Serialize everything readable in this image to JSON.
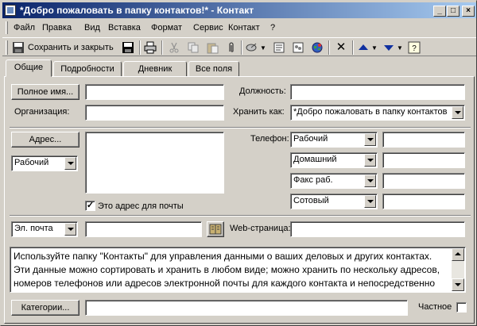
{
  "window": {
    "title": "*Добро пожаловать в папку контактов!* - Контакт",
    "buttons": [
      "_",
      "□",
      "×"
    ]
  },
  "menubar": {
    "items": [
      "Файл",
      "Правка",
      "Вид",
      "Вставка",
      "Формат",
      "Сервис",
      "Контакт",
      "?"
    ]
  },
  "toolbar": {
    "save_close_label": "Сохранить и закрыть"
  },
  "tabs": [
    "Общие",
    "Подробности",
    "Дневник",
    "Все поля"
  ],
  "general": {
    "full_name_button": "Полное имя...",
    "full_name_value": "",
    "organization_label": "Организация:",
    "organization_value": "",
    "job_title_label": "Должность:",
    "job_title_value": "",
    "file_as_label": "Хранить как:",
    "file_as_value": "*Добро пожаловать в папку контактов",
    "address_button": "Адрес...",
    "address_type": "Рабочий",
    "address_value": "",
    "mailing_address_label": "Это адрес для почты",
    "mailing_address_checked": true,
    "phone_label": "Телефон:",
    "phones": [
      {
        "type": "Рабочий",
        "value": ""
      },
      {
        "type": "Домашний",
        "value": ""
      },
      {
        "type": "Факс раб.",
        "value": ""
      },
      {
        "type": "Сотовый",
        "value": ""
      }
    ],
    "email_type": "Эл. почта",
    "email_value": "",
    "web_label": "Web-страница:",
    "web_value": "",
    "notes": "Используйте папку \"Контакты\" для управления данными о ваших деловых и других контактах. Эти данные можно сортировать и хранить в любом виде; можно хранить по нескольку адресов, номеров телефонов или адресов электронной почты для каждого контакта и непосредственно обращаться к их Web-страницам.",
    "categories_button": "Категории...",
    "categories_value": "",
    "private_label": "Частное",
    "private_checked": false
  },
  "colors": {
    "title_start": "#0a246a",
    "title_end": "#a6caf0",
    "face": "#d4d0c8"
  }
}
